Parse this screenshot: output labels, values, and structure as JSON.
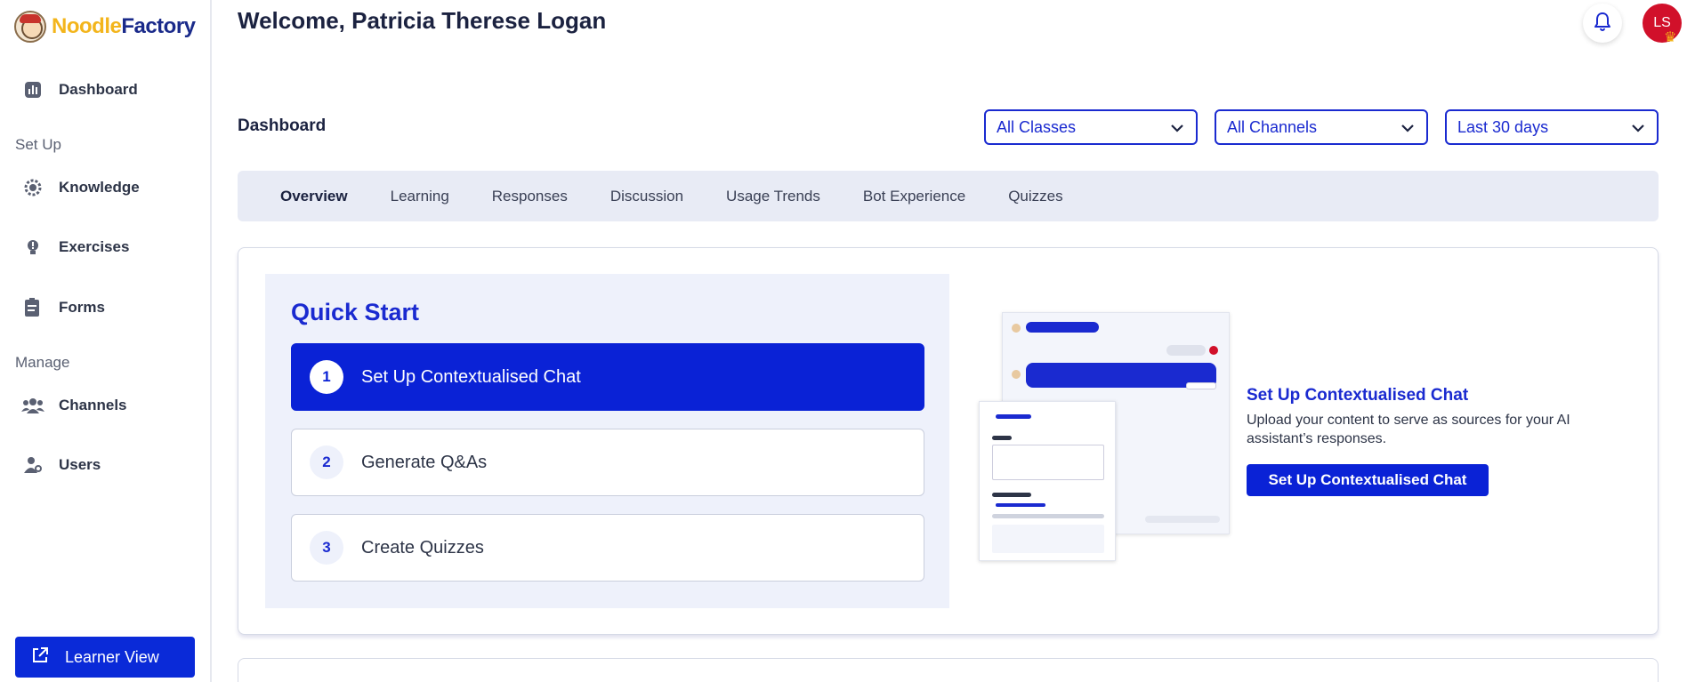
{
  "app": {
    "logo_part1": "Noodle",
    "logo_part2": "Factory"
  },
  "sidebar": {
    "items": [
      {
        "label": "Dashboard",
        "icon": "chart-icon"
      },
      {
        "label": "Knowledge",
        "icon": "brain-gear-icon"
      },
      {
        "label": "Exercises",
        "icon": "lightbulb-icon"
      },
      {
        "label": "Forms",
        "icon": "clipboard-icon"
      },
      {
        "label": "Channels",
        "icon": "users-group-icon"
      },
      {
        "label": "Users",
        "icon": "user-gear-icon"
      }
    ],
    "sections": [
      "Set Up",
      "Manage"
    ],
    "learner_view": "Learner View"
  },
  "header": {
    "welcome": "Welcome, Patricia Therese Logan",
    "avatar_initials": "LS"
  },
  "dashboard": {
    "title": "Dashboard",
    "filters": [
      "All Classes",
      "All Channels",
      "Last 30 days"
    ],
    "tabs": [
      "Overview",
      "Learning",
      "Responses",
      "Discussion",
      "Usage Trends",
      "Bot Experience",
      "Quizzes"
    ],
    "active_tab": "Overview"
  },
  "quick_start": {
    "title": "Quick Start",
    "steps": [
      {
        "num": "1",
        "label": "Set Up Contextualised Chat"
      },
      {
        "num": "2",
        "label": "Generate Q&As"
      },
      {
        "num": "3",
        "label": "Create Quizzes"
      }
    ],
    "cta_title": "Set Up Contextualised Chat",
    "cta_desc": "Upload your content to serve as sources for your AI assistant’s responses.",
    "cta_button": "Set Up Contextualised Chat"
  },
  "colors": {
    "accent": "#0a22d6",
    "brand_yellow": "#f3b51c",
    "avatar": "#d1102a",
    "panel": "#eef1fb"
  }
}
